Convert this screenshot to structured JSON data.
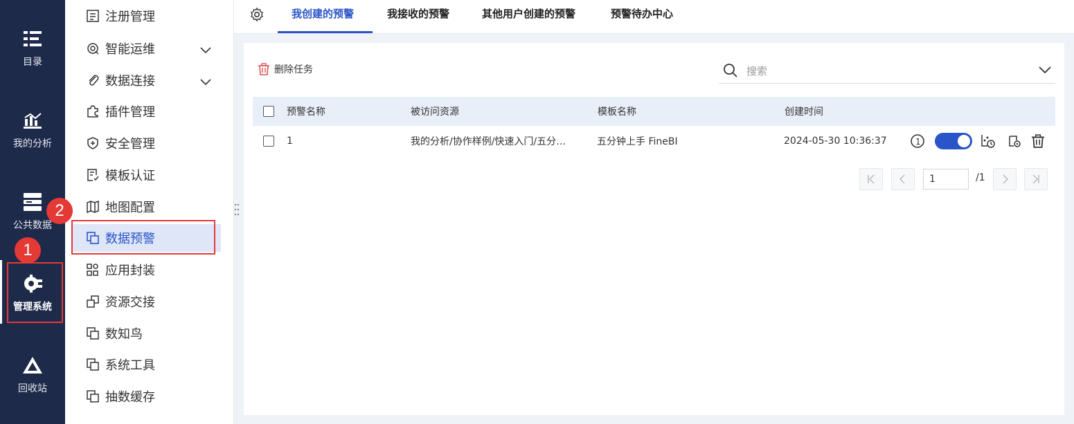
{
  "rail": {
    "items": [
      {
        "label": "目录",
        "icon": "catalog-icon"
      },
      {
        "label": "我的分析",
        "icon": "analysis-chart-icon"
      },
      {
        "label": "公共数据",
        "icon": "public-data-icon"
      },
      {
        "label": "管理系统",
        "icon": "settings-gear-icon"
      },
      {
        "label": "回收站",
        "icon": "recycle-bin-icon"
      }
    ],
    "active": "管理系统"
  },
  "annotations": {
    "badge1": "1",
    "badge2": "2",
    "color": "#e53935"
  },
  "menu": {
    "items": [
      {
        "label": "注册管理",
        "icon": "register-icon"
      },
      {
        "label": "智能运维",
        "icon": "ops-icon",
        "expandable": true
      },
      {
        "label": "数据连接",
        "icon": "paperclip-icon",
        "expandable": true
      },
      {
        "label": "插件管理",
        "icon": "puzzle-icon"
      },
      {
        "label": "安全管理",
        "icon": "shield-icon"
      },
      {
        "label": "模板认证",
        "icon": "template-cert-icon"
      },
      {
        "label": "地图配置",
        "icon": "map-icon"
      },
      {
        "label": "数据预警",
        "icon": "copy-icon",
        "selected": true
      },
      {
        "label": "应用封装",
        "icon": "grid-apps-icon"
      },
      {
        "label": "资源交接",
        "icon": "handover-icon"
      },
      {
        "label": "数知鸟",
        "icon": "copy-icon"
      },
      {
        "label": "系统工具",
        "icon": "copy-icon"
      },
      {
        "label": "抽数缓存",
        "icon": "copy-icon"
      }
    ]
  },
  "tabs": {
    "items": [
      "我创建的预警",
      "我接收的预警",
      "其他用户创建的预警",
      "预警待办中心"
    ],
    "active": "我创建的预警"
  },
  "toolbar": {
    "delete_label": "删除任务",
    "search_placeholder": "搜索"
  },
  "table": {
    "headers": [
      "预警名称",
      "被访问资源",
      "模板名称",
      "创建时间"
    ],
    "rows": [
      {
        "name": "1",
        "resource": "我的分析/协作样例/快速入门/五分…",
        "template": "五分钟上手 FineBI",
        "created": "2024-05-30 10:36:37",
        "enabled": true
      }
    ]
  },
  "pagination": {
    "current": "1",
    "total": "/1"
  },
  "colors": {
    "rail_bg": "#1e2a4a",
    "accent": "#2a55c8",
    "selected_bg": "#dfe6f8",
    "header_bg": "#e9eff8",
    "main_bg": "#eff2f6"
  }
}
